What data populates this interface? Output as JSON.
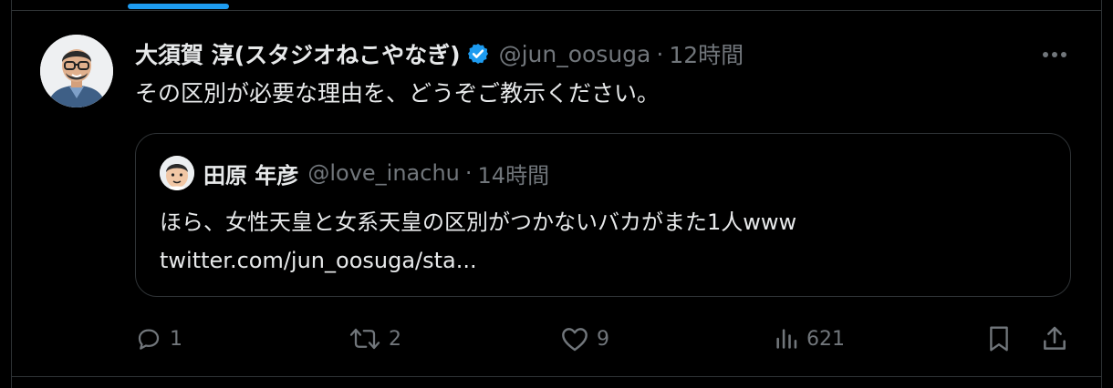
{
  "tweet": {
    "author": {
      "display_name": "大須賀 淳(スタジオねこやなぎ)",
      "handle": "@jun_oosuga",
      "verified": true
    },
    "separator": "·",
    "time": "12時間",
    "text": "その区別が必要な理由を、どうぞご教示ください。",
    "quoted": {
      "author": {
        "display_name": "田原 年彦",
        "handle": "@love_inachu"
      },
      "separator": "·",
      "time": "14時間",
      "text_line1": "ほら、女性天皇と女系天皇の区別がつかないバカがまた1人www",
      "text_line2": "twitter.com/jun_oosuga/sta..."
    },
    "actions": {
      "reply_count": "1",
      "retweet_count": "2",
      "like_count": "9",
      "views_count": "621"
    }
  },
  "colors": {
    "background": "#000000",
    "text_primary": "#e7e9ea",
    "text_secondary": "#71767b",
    "border": "#2f3336",
    "accent": "#1d9bf0"
  },
  "icons": {
    "reply": "reply-icon",
    "retweet": "retweet-icon",
    "like": "heart-icon",
    "views": "views-chart-icon",
    "bookmark": "bookmark-icon",
    "share": "share-icon",
    "more": "more-dots-icon",
    "verified": "verified-badge-icon"
  }
}
